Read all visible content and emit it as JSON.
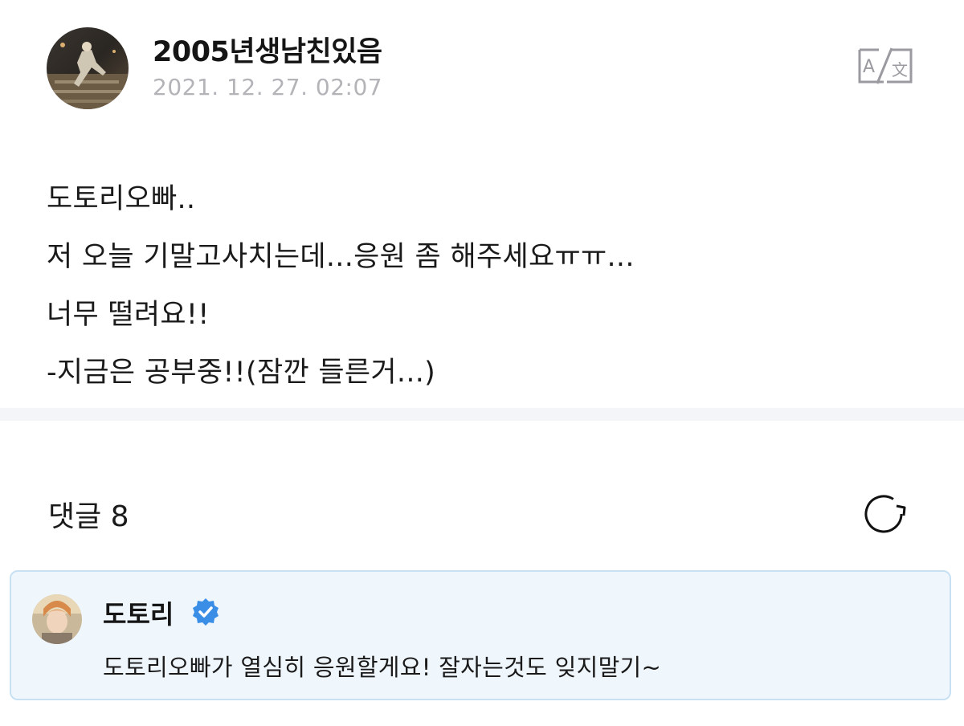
{
  "post": {
    "author": "2005년생남친있음",
    "date": "2021. 12. 27. 02:07",
    "translate_icon": "translate-icon",
    "lines": [
      "도토리오빠..",
      "저 오늘 기말고사치는데...응원 좀 해주세요ㅠㅠ...",
      "너무 떨려요!!",
      "-지금은 공부중!!(잠깐 들른거...)"
    ]
  },
  "comments": {
    "label": "댓글 8",
    "refresh_icon": "refresh-icon",
    "items": [
      {
        "author": "도토리",
        "verified": true,
        "text": "도토리오빠가 열심히 응원할게요! 잘자는것도 잊지말기~"
      }
    ]
  },
  "colors": {
    "comment_bg": "#eff7fd",
    "comment_border": "#c7e1f3",
    "verified_blue": "#3a8ee6",
    "date_gray": "#b3b3b8"
  }
}
